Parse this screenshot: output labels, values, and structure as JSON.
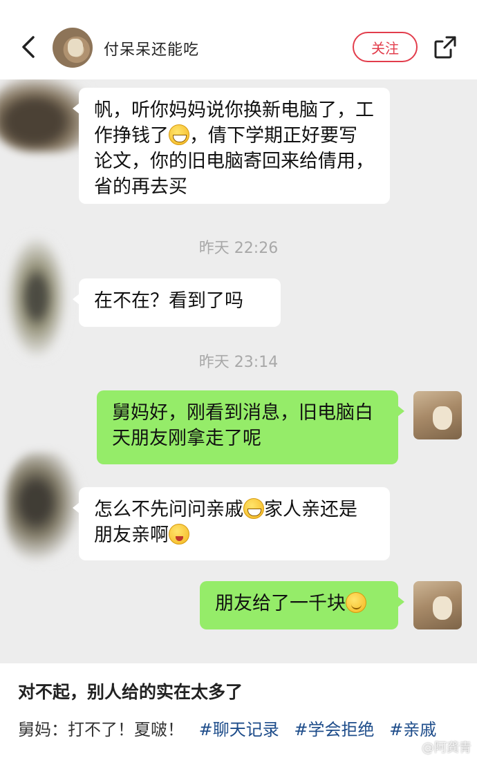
{
  "header": {
    "username": "付呆呆还能吃",
    "follow_label": "关注"
  },
  "chat": {
    "messages": [
      {
        "side": "left",
        "text_parts": [
          "帆，听你妈妈说你换新电脑了，工作挣钱了",
          "，倩下学期正好要写论文，你的旧电脑寄回来给倩用，省的再去买"
        ]
      },
      {
        "side": "timestamp",
        "text": "昨天 22:26"
      },
      {
        "side": "left",
        "text": "在不在？看到了吗"
      },
      {
        "side": "timestamp",
        "text": "昨天 23:14"
      },
      {
        "side": "right",
        "text": "舅妈好，刚看到消息，旧电脑白天朋友刚拿走了呢"
      },
      {
        "side": "left",
        "text_parts": [
          "怎么不先问问亲戚",
          "家人亲还是朋友亲啊",
          ""
        ]
      },
      {
        "side": "right",
        "text": "朋友给了一千块"
      }
    ]
  },
  "post": {
    "title": "对不起，别人给的实在太多了",
    "body_text": "舅妈：打不了！夏啵！",
    "hashtags": [
      "#聊天记录",
      "#学会拒绝",
      "#亲戚"
    ]
  },
  "watermark": "@阿龚青",
  "colors": {
    "accent_red": "#e23c4b",
    "bubble_green": "#95ec69",
    "chat_bg": "#ededed",
    "hashtag_blue": "#1d4c8a"
  },
  "icons": [
    "back-chevron-icon",
    "share-external-icon",
    "grin-emoji-icon",
    "wink-emoji-icon",
    "smile-emoji-icon"
  ]
}
